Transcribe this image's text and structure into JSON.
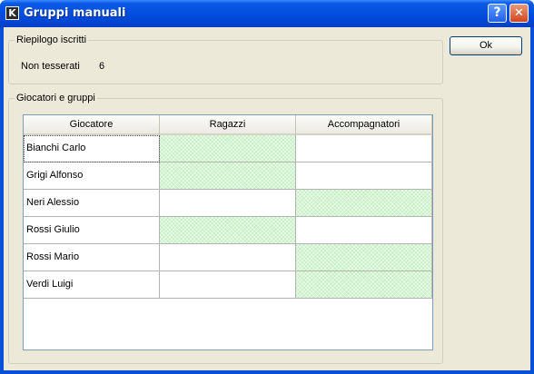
{
  "window": {
    "title": "Gruppi manuali",
    "app_icon_letter": "K"
  },
  "buttons": {
    "ok": "Ok",
    "help": "?",
    "close": "✕"
  },
  "summary": {
    "legend": "Riepilogo iscritti",
    "label": "Non tesserati",
    "value": "6"
  },
  "players": {
    "legend": "Giocatori e gruppi",
    "columns": [
      "Giocatore",
      "Ragazzi",
      "Accompagnatori"
    ],
    "rows": [
      {
        "name": "Bianchi Carlo",
        "group": "Ragazzi"
      },
      {
        "name": "Grigi Alfonso",
        "group": "Ragazzi"
      },
      {
        "name": "Neri Alessio",
        "group": "Accompagnatori"
      },
      {
        "name": "Rossi Giulio",
        "group": "Ragazzi"
      },
      {
        "name": "Rossi Mario",
        "group": "Accompagnatori"
      },
      {
        "name": "Verdi Luigi",
        "group": "Accompagnatori"
      }
    ]
  },
  "colors": {
    "selected_cell": "#c3f0c1",
    "title_bar": "#0551e0",
    "dialog_bg": "#ece9d8"
  }
}
